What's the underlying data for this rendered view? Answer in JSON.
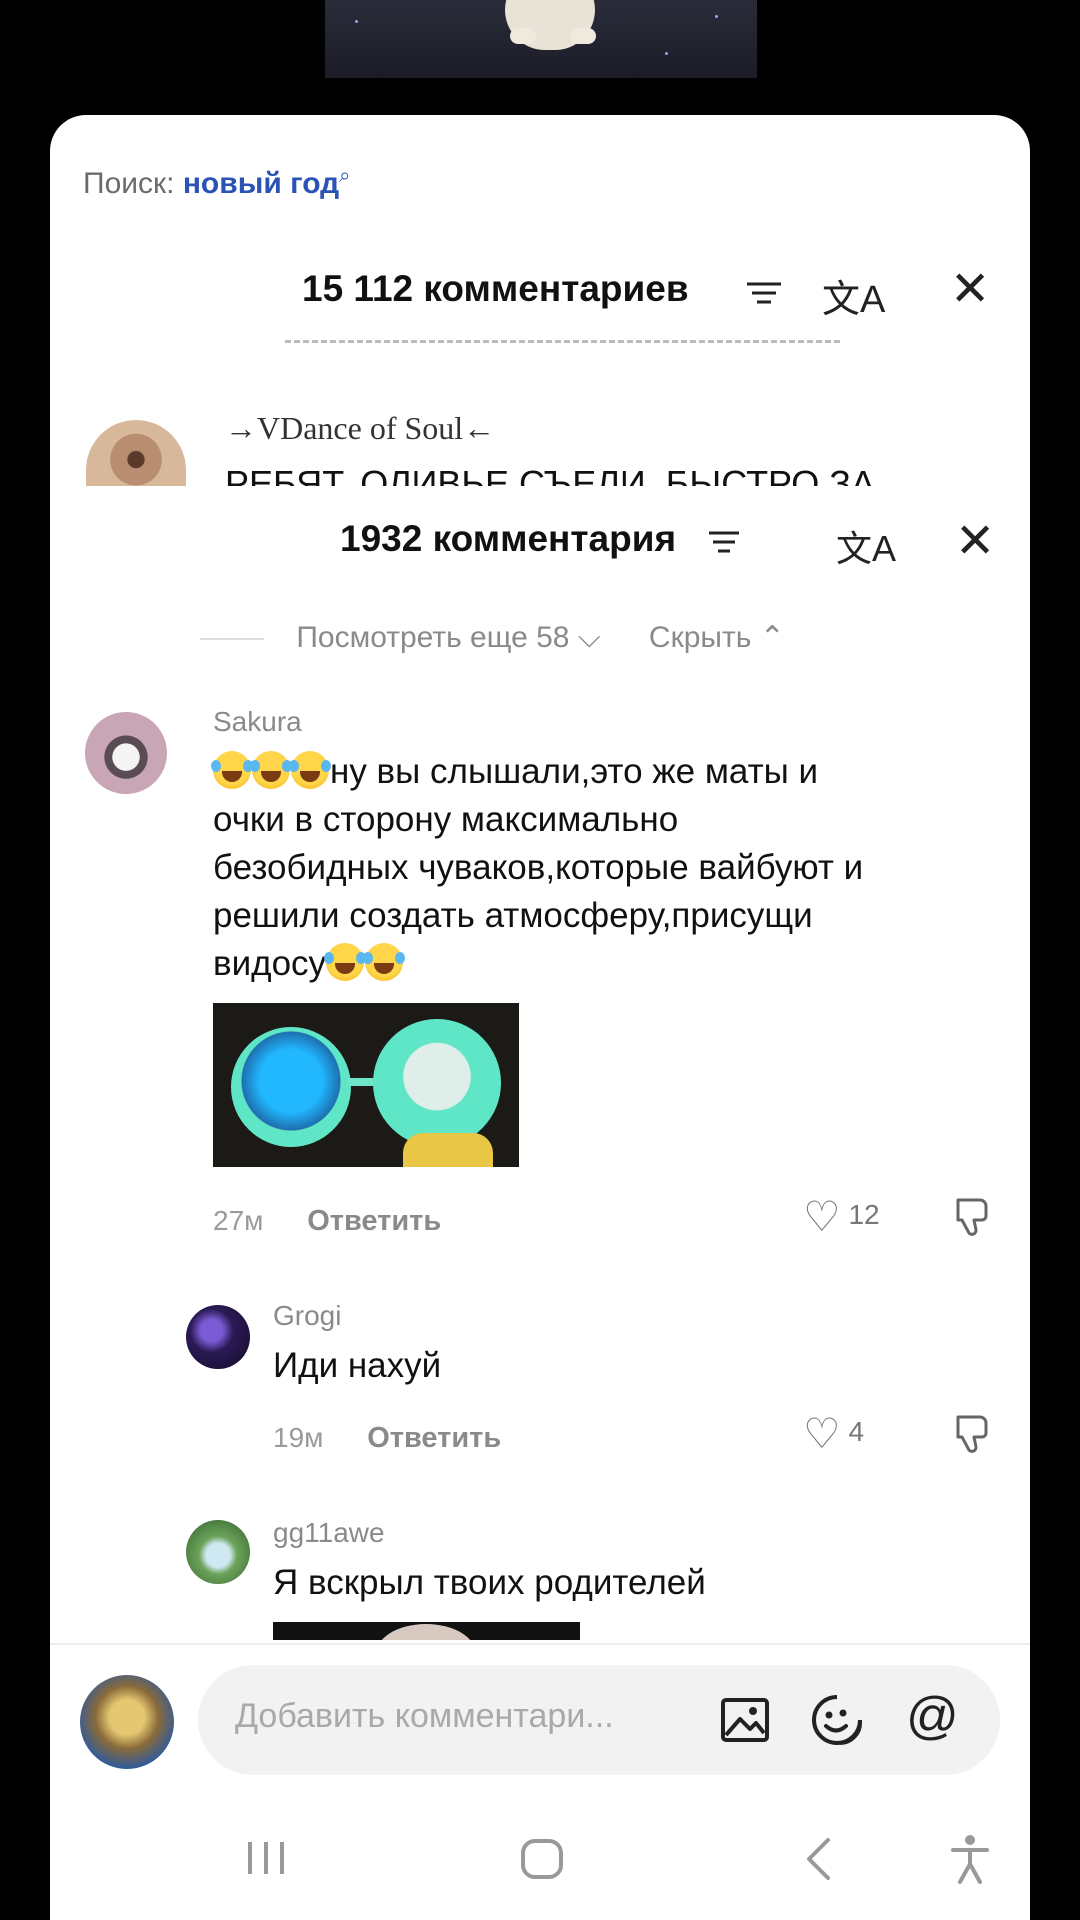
{
  "search": {
    "label": "Поиск:",
    "query": "новый год",
    "icon": "search-icon"
  },
  "outer_sheet": {
    "title": "15 112 комментариев",
    "peek_comment": {
      "username": "→VDance of Soul←",
      "text": "РЕБЯТ, ОЛИВЬЕ СЪЕЛИ, БЫСТРО ЗА"
    }
  },
  "inner_sheet": {
    "title": "1932 комментария",
    "show_more": "Посмотреть еще 58",
    "hide": "Скрыть"
  },
  "comments": [
    {
      "username": "Sakura",
      "text_lines": [
        "ну вы слышали,это же маты и",
        "очки в сторону максимально",
        "безобидных чуваков,которые вайбуют и",
        "решили создать атмосферу,присущи",
        "видосу"
      ],
      "time": "27м",
      "reply": "Ответить",
      "likes": "12"
    },
    {
      "username": "Grogi",
      "text": "Иди нахуй",
      "time": "19м",
      "reply": "Ответить",
      "likes": "4"
    },
    {
      "username": "gg11awe",
      "text": "Я вскрыл твоих родителей"
    }
  ],
  "composer": {
    "placeholder": "Добавить комментари..."
  },
  "icons": {
    "sort": "sort-icon",
    "translate": "translate-icon",
    "close": "close-icon",
    "like": "heart-icon",
    "dislike": "dislike-icon",
    "image": "image-icon",
    "sticker": "sticker-icon",
    "mention": "at-icon",
    "nav_recent": "recent-apps-icon",
    "nav_home": "home-icon",
    "nav_back": "back-icon",
    "nav_accessibility": "accessibility-icon"
  }
}
